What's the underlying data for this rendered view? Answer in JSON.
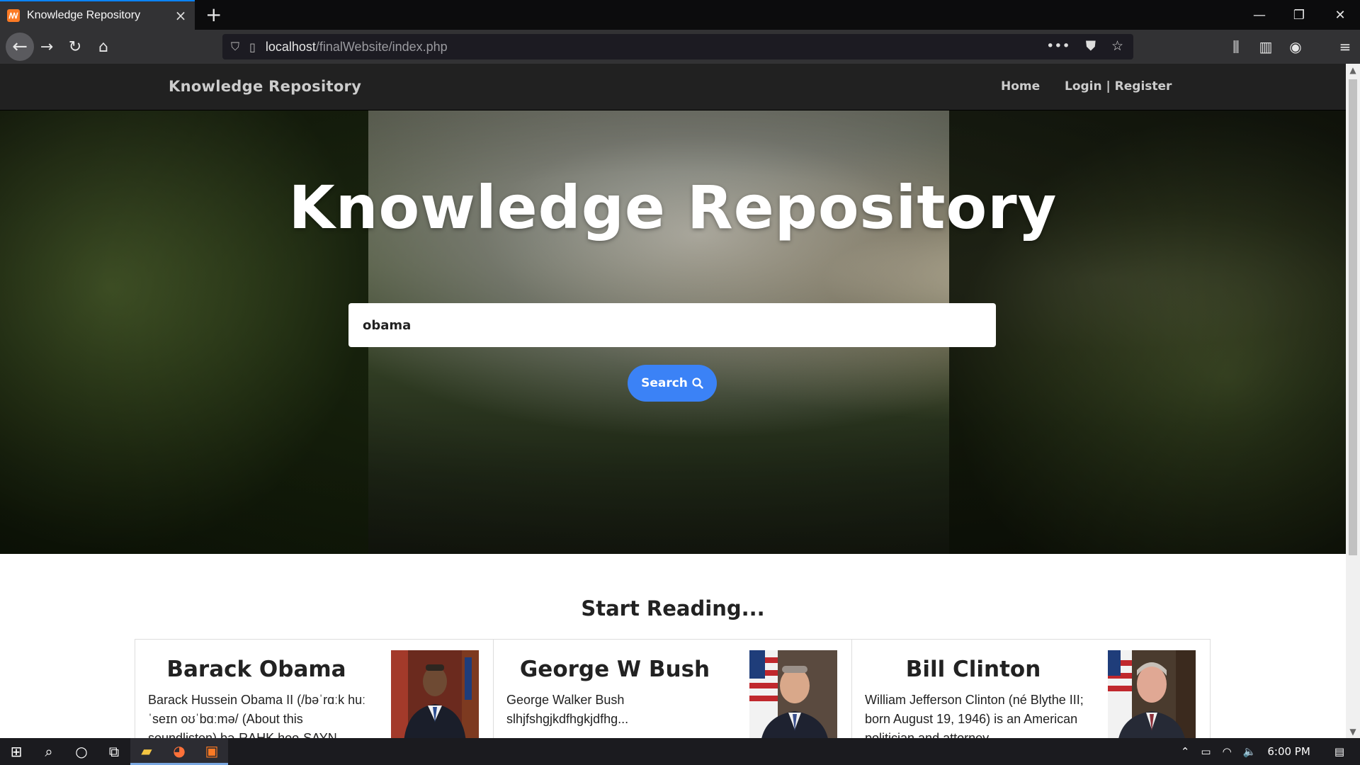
{
  "browser": {
    "tab_title": "Knowledge Repository",
    "tab_favicon": "xampp-icon",
    "new_tab": "+",
    "url_host": "localhost",
    "url_path": "/finalWebsite/index.php"
  },
  "site": {
    "brand": "Knowledge Repository",
    "nav_home": "Home",
    "nav_auth": "Login | Register"
  },
  "hero": {
    "title": "Knowledge Repository",
    "search_value": "obama",
    "search_button": "Search"
  },
  "section": {
    "title": "Start Reading..."
  },
  "cards": [
    {
      "name": "Barack Obama",
      "desc": "Barack Hussein Obama II (/bəˈrɑːk huːˈseɪn oʊˈbɑːmə/ (About this soundlisten) bə-RAHK hoo-SAYN"
    },
    {
      "name": "George W Bush",
      "desc": "George Walker Bush slhjfshgjkdfhgkjdfhg..."
    },
    {
      "name": "Bill Clinton",
      "desc": "William Jefferson Clinton (né Blythe III; born August 19, 1946) is an American politician and attorney"
    }
  ],
  "taskbar": {
    "time": "6:00 PM"
  },
  "colors": {
    "accent": "#3b82f6",
    "header_bg": "#212121",
    "browser_chrome": "#323234"
  }
}
